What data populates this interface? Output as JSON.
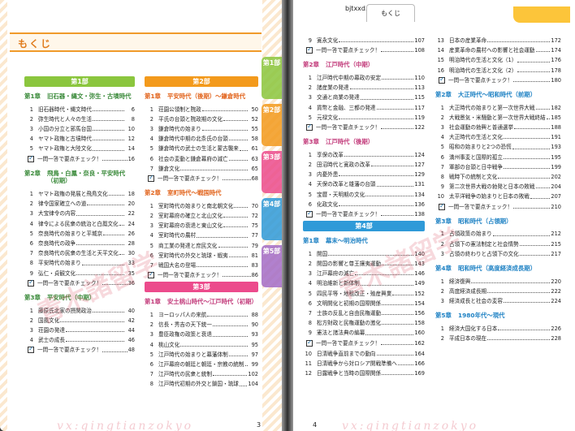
{
  "header": {
    "site": "bjtxxd.taobao.com",
    "tab": "もくじ"
  },
  "left": {
    "title": "もくじ",
    "page_number": "3",
    "side_tabs": [
      "第1部",
      "第2部",
      "第3部",
      "第4部",
      "第5部"
    ],
    "col1": [
      {
        "kind": "part",
        "label": "第1部",
        "color": "#8bc63e"
      },
      {
        "kind": "chap",
        "num": "第1章",
        "title": "旧石器・縄文・弥生・古墳時代",
        "c": "g"
      },
      {
        "kind": "item",
        "n": "1",
        "t": "旧石器時代・縄文時代",
        "p": "6"
      },
      {
        "kind": "item",
        "n": "2",
        "t": "弥生時代と人々の生活",
        "p": "8"
      },
      {
        "kind": "item",
        "n": "3",
        "t": "小国の分立と邪馬台国",
        "p": "10"
      },
      {
        "kind": "item",
        "n": "4",
        "t": "ヤマト政権と古墳時代",
        "p": "12"
      },
      {
        "kind": "item",
        "n": "5",
        "t": "ヤマト政権と大陸文化",
        "p": "14"
      },
      {
        "kind": "check",
        "t": "一問一答で要点チェック！",
        "p": "16"
      },
      {
        "kind": "chap",
        "num": "第2章",
        "title": "飛鳥・白鳳・奈良・平安時代（初期）",
        "c": "g"
      },
      {
        "kind": "item",
        "n": "1",
        "t": "ヤマト政権の発展と飛鳥文化",
        "p": "18"
      },
      {
        "kind": "item",
        "n": "2",
        "t": "律令国家確立への道",
        "p": "20"
      },
      {
        "kind": "item",
        "n": "3",
        "t": "大宝律令の内容",
        "p": "22"
      },
      {
        "kind": "item",
        "n": "4",
        "t": "律令による民衆の統治と白鳳文化",
        "p": "24"
      },
      {
        "kind": "item",
        "n": "5",
        "t": "奈良時代の始まりと平城京",
        "p": "26"
      },
      {
        "kind": "item",
        "n": "6",
        "t": "奈良時代の政争",
        "p": "28"
      },
      {
        "kind": "item",
        "n": "7",
        "t": "奈良時代の民衆の生活と天平文化",
        "p": "30"
      },
      {
        "kind": "item",
        "n": "8",
        "t": "平安時代の始まり",
        "p": "33"
      },
      {
        "kind": "item",
        "n": "9",
        "t": "弘仁・貞観文化",
        "p": "35"
      },
      {
        "kind": "check",
        "t": "一問一答で要点チェック！",
        "p": "36"
      },
      {
        "kind": "chap",
        "num": "第3章",
        "title": "平安時代（中期）",
        "c": "g"
      },
      {
        "kind": "item",
        "n": "1",
        "t": "藤原氏北家の摂関政治",
        "p": "40"
      },
      {
        "kind": "item",
        "n": "2",
        "t": "国風文化",
        "p": "42"
      },
      {
        "kind": "item",
        "n": "3",
        "t": "荘園の発達",
        "p": "44"
      },
      {
        "kind": "item",
        "n": "4",
        "t": "武士の成長",
        "p": "46"
      },
      {
        "kind": "check",
        "t": "一問一答で要点チェック！",
        "p": "48"
      }
    ],
    "col2": [
      {
        "kind": "part",
        "label": "第2部",
        "color": "#f39a1c"
      },
      {
        "kind": "chap",
        "num": "第1章",
        "title": "平安時代（後期）～鎌倉時代",
        "c": "o"
      },
      {
        "kind": "item",
        "n": "1",
        "t": "荘園公領制と院政",
        "p": "50"
      },
      {
        "kind": "item",
        "n": "2",
        "t": "平氏の台頭と院政期の文化",
        "p": "52"
      },
      {
        "kind": "item",
        "n": "3",
        "t": "鎌倉時代の始まり",
        "p": "55"
      },
      {
        "kind": "item",
        "n": "4",
        "t": "鎌倉時代中期の北条氏の台頭",
        "p": "58"
      },
      {
        "kind": "item",
        "n": "5",
        "t": "鎌倉時代の武士の生活と蒙古襲来",
        "p": "61"
      },
      {
        "kind": "item",
        "n": "6",
        "t": "社会の変動と鎌倉幕府の滅亡",
        "p": "63"
      },
      {
        "kind": "item",
        "n": "7",
        "t": "鎌倉文化",
        "p": "65"
      },
      {
        "kind": "check",
        "t": "一問一答で要点チェック！",
        "p": "68"
      },
      {
        "kind": "chap",
        "num": "第2章",
        "title": "室町時代～戦国時代",
        "c": "o"
      },
      {
        "kind": "item",
        "n": "1",
        "t": "室町時代の始まりと南北朝文化",
        "p": "70"
      },
      {
        "kind": "item",
        "n": "2",
        "t": "室町幕府の確立と北山文化",
        "p": "72"
      },
      {
        "kind": "item",
        "n": "3",
        "t": "室町幕府の衰退と東山文化",
        "p": "75"
      },
      {
        "kind": "item",
        "n": "4",
        "t": "室町時代の農村",
        "p": "77"
      },
      {
        "kind": "item",
        "n": "5",
        "t": "商工業の発達と庶民文化",
        "p": "79"
      },
      {
        "kind": "item",
        "n": "6",
        "t": "室町時代の外交と琉球・蝦夷",
        "p": "81"
      },
      {
        "kind": "item",
        "n": "7",
        "t": "戦国大名の登場",
        "p": "83"
      },
      {
        "kind": "check",
        "t": "一問一答で要点チェック！",
        "p": "86"
      },
      {
        "kind": "part",
        "label": "第3部",
        "color": "#ec4b8c"
      },
      {
        "kind": "chap",
        "num": "第1章",
        "title": "安土桃山時代～江戸時代（初期）",
        "c": "p"
      },
      {
        "kind": "item",
        "n": "1",
        "t": "ヨーロッパ人の来航",
        "p": "88"
      },
      {
        "kind": "item",
        "n": "2",
        "t": "信長・秀吉の天下統一",
        "p": "90"
      },
      {
        "kind": "item",
        "n": "3",
        "t": "豊臣政権の政策と衰退",
        "p": "93"
      },
      {
        "kind": "item",
        "n": "4",
        "t": "桃山文化",
        "p": "95"
      },
      {
        "kind": "item",
        "n": "5",
        "t": "江戸時代の始まりと幕藩体制",
        "p": "97"
      },
      {
        "kind": "item",
        "n": "6",
        "t": "江戸幕府の朝廷と朝廷・宗教の統制",
        "p": "99"
      },
      {
        "kind": "item",
        "n": "7",
        "t": "江戸時代の民衆と統制",
        "p": "102"
      },
      {
        "kind": "item",
        "n": "8",
        "t": "江戸時代初期の外交と鎖国・琉球",
        "p": "104"
      }
    ]
  },
  "right": {
    "page_number": "4",
    "col1": [
      {
        "kind": "item",
        "n": "9",
        "t": "寛永文化",
        "p": "107"
      },
      {
        "kind": "check",
        "t": "一問一答で要点チェック！",
        "p": "108"
      },
      {
        "kind": "chap",
        "num": "第2章",
        "title": "江戸時代（中期）",
        "c": "p"
      },
      {
        "kind": "item",
        "n": "1",
        "t": "江戸時代中期の幕政の安定",
        "p": "110"
      },
      {
        "kind": "item",
        "n": "2",
        "t": "諸産業の発達",
        "p": "113"
      },
      {
        "kind": "item",
        "n": "3",
        "t": "交通と商業の発達",
        "p": "115"
      },
      {
        "kind": "item",
        "n": "4",
        "t": "貨幣と金融、三都の発達",
        "p": "117"
      },
      {
        "kind": "item",
        "n": "5",
        "t": "元禄文化",
        "p": "119"
      },
      {
        "kind": "check",
        "t": "一問一答で要点チェック！",
        "p": "122"
      },
      {
        "kind": "chap",
        "num": "第3章",
        "title": "江戸時代（後期）",
        "c": "p"
      },
      {
        "kind": "item",
        "n": "1",
        "t": "享保の改革",
        "p": "124"
      },
      {
        "kind": "item",
        "n": "2",
        "t": "田沼時代と寛政の改革",
        "p": "127"
      },
      {
        "kind": "item",
        "n": "3",
        "t": "内憂外患",
        "p": "129"
      },
      {
        "kind": "item",
        "n": "4",
        "t": "天保の改革と雄藩の台頭",
        "p": "131"
      },
      {
        "kind": "item",
        "n": "5",
        "t": "宝暦・天明期の文化",
        "p": "134"
      },
      {
        "kind": "item",
        "n": "6",
        "t": "化政文化",
        "p": "136"
      },
      {
        "kind": "check",
        "t": "一問一答で要点チェック！",
        "p": "138"
      },
      {
        "kind": "part",
        "label": "第4部",
        "color": "#2f9ad8"
      },
      {
        "kind": "chap",
        "num": "第1章",
        "title": "幕末～明治時代",
        "c": "b"
      },
      {
        "kind": "item",
        "n": "1",
        "t": "開国",
        "p": "140"
      },
      {
        "kind": "item",
        "n": "2",
        "t": "開国の影響と尊王攘夷運動",
        "p": "143"
      },
      {
        "kind": "item",
        "n": "3",
        "t": "江戸幕府の滅亡",
        "p": "146"
      },
      {
        "kind": "item",
        "n": "4",
        "t": "明治維新と新体制",
        "p": "149"
      },
      {
        "kind": "item",
        "n": "5",
        "t": "四民平等・地租改正・殖産興業",
        "p": "152"
      },
      {
        "kind": "item",
        "n": "6",
        "t": "文明開化と初期の国際関係",
        "p": "154"
      },
      {
        "kind": "item",
        "n": "7",
        "t": "士族の反乱と自由民権運動",
        "p": "156"
      },
      {
        "kind": "item",
        "n": "8",
        "t": "松方財政と民権運動の激化",
        "p": "158"
      },
      {
        "kind": "item",
        "n": "9",
        "t": "憲法と諸法典の編纂",
        "p": "160"
      },
      {
        "kind": "check",
        "t": "一問一答で要点チェック！",
        "p": "162"
      },
      {
        "kind": "item",
        "n": "10",
        "t": "日清戦争直前までの動向",
        "p": "164"
      },
      {
        "kind": "item",
        "n": "11",
        "t": "日清戦争から対ロシア開戦準備へ",
        "p": "166"
      },
      {
        "kind": "item",
        "n": "12",
        "t": "日露戦争と当時の国際関係",
        "p": "169"
      }
    ],
    "col2": [
      {
        "kind": "item",
        "n": "13",
        "t": "日本の産業革命",
        "p": "172"
      },
      {
        "kind": "item",
        "n": "14",
        "t": "産業革命の農村への影響と社会運動",
        "p": "174"
      },
      {
        "kind": "item",
        "n": "15",
        "t": "明治時代の生活と文化（1）",
        "p": "176"
      },
      {
        "kind": "item",
        "n": "16",
        "t": "明治時代の生活と文化（2）",
        "p": "178"
      },
      {
        "kind": "check",
        "t": "一問一答で要点チェック！",
        "p": "180"
      },
      {
        "kind": "chap",
        "num": "第2章",
        "title": "大正時代～昭和時代（前期）",
        "c": "b"
      },
      {
        "kind": "item",
        "n": "1",
        "t": "大正時代の始まりと第一次世界大戦",
        "p": "182"
      },
      {
        "kind": "item",
        "n": "2",
        "t": "大戦景気・米騒動と第一次世界大戦終結",
        "p": "185"
      },
      {
        "kind": "item",
        "n": "3",
        "t": "社会運動の勃興と普通選挙",
        "p": "188"
      },
      {
        "kind": "item",
        "n": "4",
        "t": "大正時代の生活と文化",
        "p": "191"
      },
      {
        "kind": "item",
        "n": "5",
        "t": "昭和の始まりと2つの恐慌",
        "p": "193"
      },
      {
        "kind": "item",
        "n": "6",
        "t": "満州事変と国際的孤立",
        "p": "195"
      },
      {
        "kind": "item",
        "n": "7",
        "t": "軍部の台頭と日中戦争",
        "p": "199"
      },
      {
        "kind": "item",
        "n": "8",
        "t": "戦時下の統制と文化",
        "p": "202"
      },
      {
        "kind": "item",
        "n": "9",
        "t": "第二次世界大戦の勃発と日本の敗戦",
        "p": "204"
      },
      {
        "kind": "item",
        "n": "10",
        "t": "太平洋戦争の始まりと日本の敗戦",
        "p": "207"
      },
      {
        "kind": "check",
        "t": "一問一答で要点チェック！",
        "p": "210"
      },
      {
        "kind": "chap",
        "num": "第3章",
        "title": "昭和時代（占領期）",
        "c": "b"
      },
      {
        "kind": "item",
        "n": "1",
        "t": "占領政策の始まり",
        "p": "212"
      },
      {
        "kind": "item",
        "n": "2",
        "t": "占領下の憲法制定と社会情勢",
        "p": "215"
      },
      {
        "kind": "item",
        "n": "3",
        "t": "占領の終わりと占領下の文化",
        "p": "217"
      },
      {
        "kind": "chap",
        "num": "第4章",
        "title": "昭和時代（高度経済成長期）",
        "c": "b"
      },
      {
        "kind": "item",
        "n": "1",
        "t": "経済復興",
        "p": "220"
      },
      {
        "kind": "item",
        "n": "2",
        "t": "高度経済成長期",
        "p": "222"
      },
      {
        "kind": "item",
        "n": "3",
        "t": "経済成長と社会の変容",
        "p": "224"
      },
      {
        "kind": "chap",
        "num": "第5章",
        "title": "1980年代～現代",
        "c": "b"
      },
      {
        "kind": "item",
        "n": "1",
        "t": "経済大国化する日本",
        "p": "226"
      },
      {
        "kind": "item",
        "n": "2",
        "t": "平成日本の現在",
        "p": "228"
      }
    ]
  },
  "watermark": {
    "cn": "青木諸留学",
    "url": "vx:qingtianzokyo"
  },
  "colors": {
    "part1": "#8bc63e",
    "part2": "#f39a1c",
    "part3": "#ec4b8c",
    "part4": "#2f9ad8",
    "accent": "#e07b1a"
  }
}
